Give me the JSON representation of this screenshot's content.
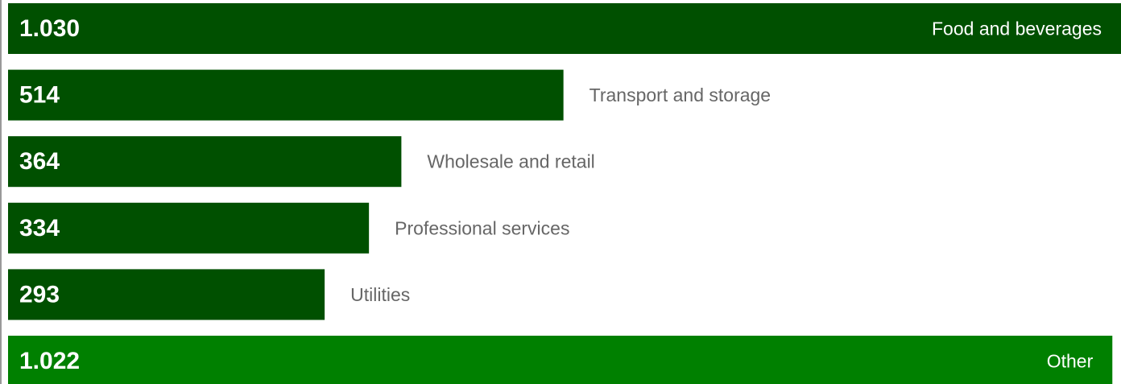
{
  "chart_data": {
    "type": "bar",
    "orientation": "horizontal",
    "title": "",
    "xlabel": "",
    "ylabel": "",
    "categories": [
      "Food and beverages",
      "Transport and storage",
      "Wholesale and retail",
      "Professional services",
      "Utilities",
      "Other"
    ],
    "values": [
      1030,
      514,
      364,
      334,
      293,
      1022
    ],
    "value_labels": [
      "1.030",
      "514",
      "364",
      "334",
      "293",
      "1.022"
    ],
    "xlim": [
      0,
      1030
    ],
    "grid": false,
    "legend": "none",
    "colors": {
      "primary": "#005000",
      "highlight": "#008000",
      "value_text": "#ffffff",
      "label_outside": "#666666",
      "label_inside": "#ffffff",
      "axis": "#999999"
    },
    "highlighted_categories": [
      "Other"
    ]
  }
}
